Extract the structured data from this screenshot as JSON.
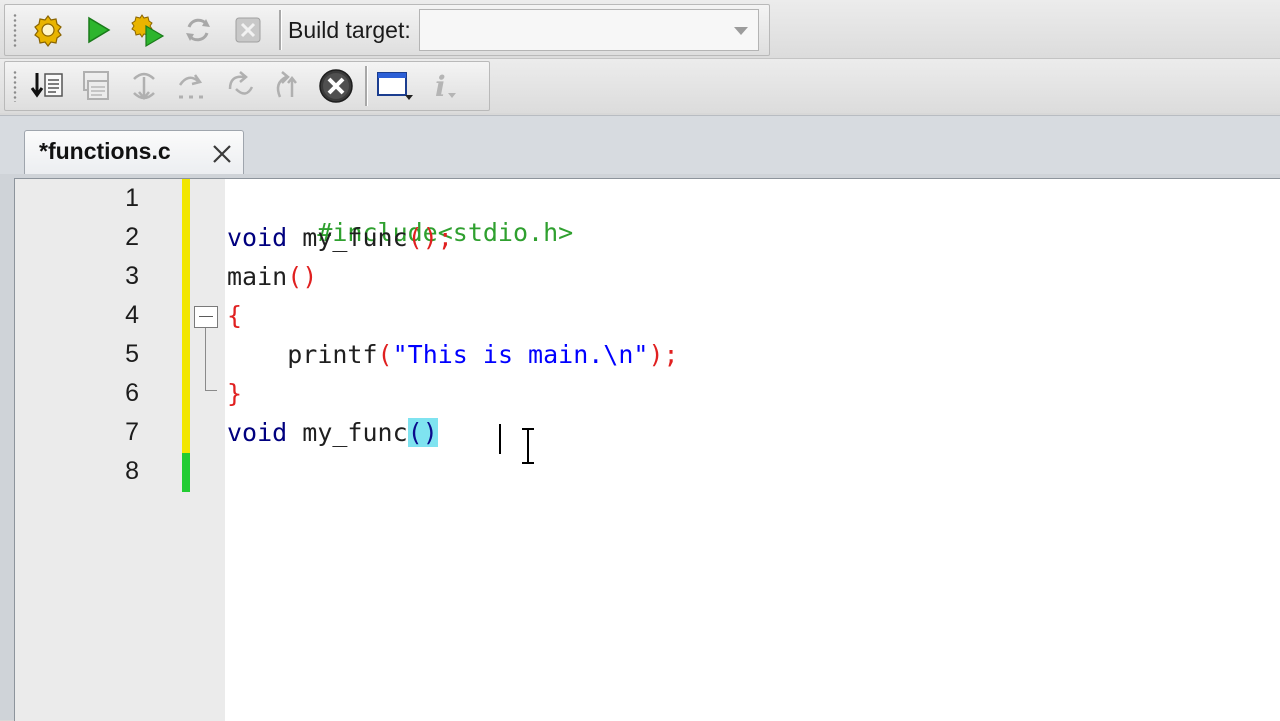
{
  "toolbar_build": {
    "icons": [
      "build-settings-icon",
      "run-icon",
      "build-and-run-icon",
      "rebuild-icon",
      "abort-icon"
    ],
    "build_target_label": "Build target:",
    "build_target_value": ""
  },
  "toolbar_debug": {
    "icons": [
      "step-into-file-icon",
      "debug-windows-icon",
      "step-into-icon",
      "next-line-icon",
      "step-out-icon",
      "next-instruction-icon",
      "stop-debugger-icon",
      "debugging-windows-icon",
      "info-icon"
    ]
  },
  "editor": {
    "tab_label": "*functions.c",
    "line_numbers": [
      "1",
      "2",
      "3",
      "4",
      "5",
      "6",
      "7",
      "8"
    ],
    "lines": {
      "l1": {
        "text": "#include<stdio.h>"
      },
      "l2": {
        "kw": "void",
        "rest": " my_func",
        "punct": "();"
      },
      "l3": {
        "name": "main",
        "punct": "()"
      },
      "l4": {
        "brace": "{"
      },
      "l5": {
        "indent": "    ",
        "fn": "printf",
        "open": "(",
        "str": "\"This is main.\\n\"",
        "close": ");"
      },
      "l6": {
        "brace": "}"
      },
      "l7": {
        "kw": "void",
        "rest": " my_func",
        "hl": "()"
      },
      "l8": {
        "text": ""
      }
    },
    "colors": {
      "preprocessor": "#2fa02f",
      "keyword": "#00007f",
      "operator": "#e02020",
      "string": "#0000ff",
      "changed_saved": "#f2e600",
      "changed_unsaved": "#22cc33",
      "brace_match": "#7fe3f0"
    }
  }
}
